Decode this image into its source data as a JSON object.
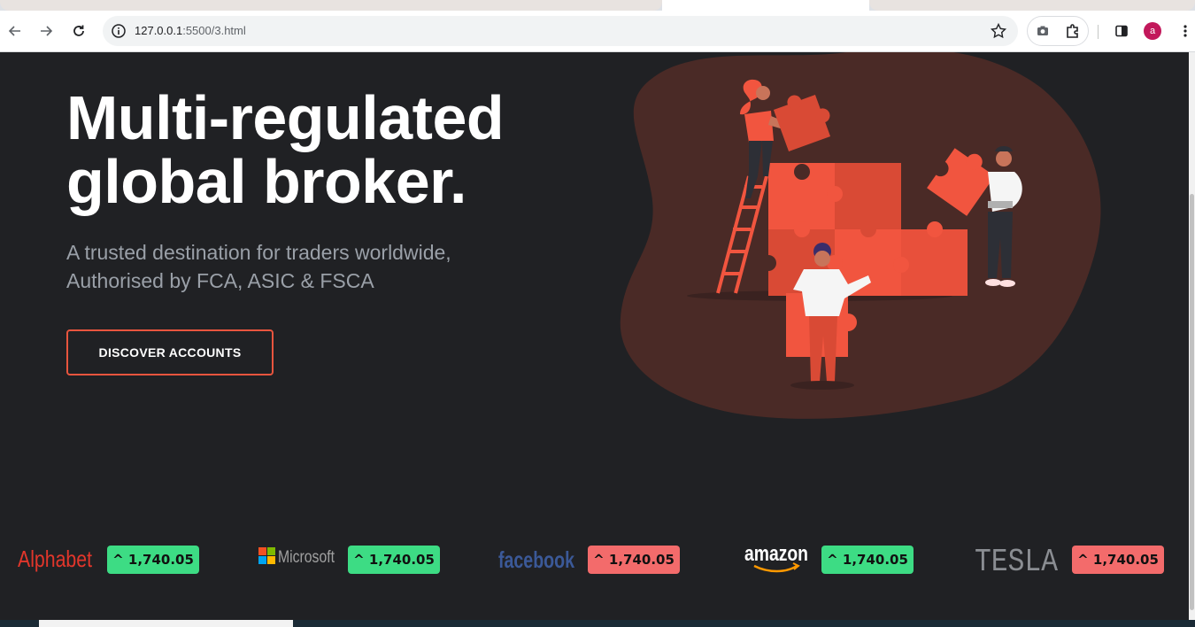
{
  "browser": {
    "url_host": "127.0.0.1",
    "url_rest": ":5500/3.html",
    "profile_initial": "a"
  },
  "hero": {
    "title_line1": "Multi-regulated",
    "title_line2": "global broker.",
    "subtitle_line1": "A trusted destination for traders worldwide,",
    "subtitle_line2": "Authorised by FCA, ASIC & FSCA",
    "cta_label": "DISCOVER ACCOUNTS"
  },
  "ticker": [
    {
      "company": "Alphabet",
      "price": "^ 1,740.05",
      "trend": "up"
    },
    {
      "company": "Microsoft",
      "price": "^ 1,740.05",
      "trend": "up"
    },
    {
      "company": "facebook",
      "price": "^ 1,740.05",
      "trend": "down"
    },
    {
      "company": "amazon",
      "price": "^ 1,740.05",
      "trend": "up"
    },
    {
      "company": "TESLA",
      "price": "^ 1,740.05",
      "trend": "down"
    }
  ],
  "colors": {
    "background": "#202124",
    "accent": "#e8553e",
    "up": "#3ddc84",
    "down": "#f36b6b",
    "blob": "#4a2a26"
  },
  "icons": [
    "back-icon",
    "forward-icon",
    "reload-icon",
    "info-icon",
    "star-icon",
    "camera-icon",
    "extensions-icon",
    "side-panel-icon",
    "menu-icon"
  ]
}
